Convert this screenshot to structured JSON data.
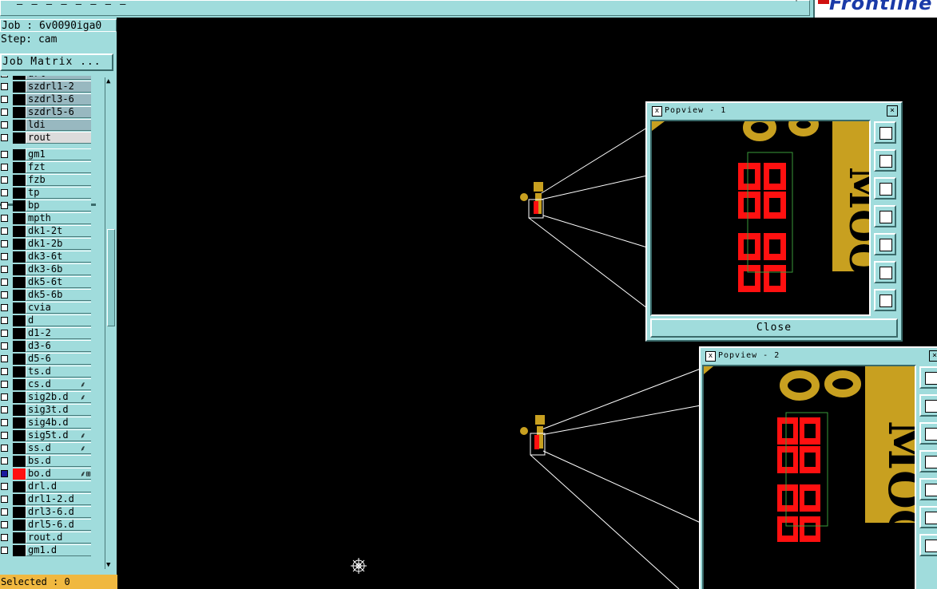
{
  "window": {
    "title": "–   –    –    –    –    –    –   –",
    "logo_text": "Frontline",
    "corner_mark": "'"
  },
  "sidebar": {
    "job": "Job : 6v0090iga0",
    "step": "Step: cam",
    "matrix_button": "Job Matrix ...",
    "layers": [
      {
        "name": "drl",
        "style": "grey",
        "checked": false
      },
      {
        "name": "szdrl1-2",
        "style": "grey",
        "checked": false
      },
      {
        "name": "szdrl3-6",
        "style": "grey",
        "checked": false
      },
      {
        "name": "szdrl5-6",
        "style": "grey",
        "checked": false
      },
      {
        "name": "ldi",
        "style": "grey",
        "checked": false
      },
      {
        "name": "rout",
        "style": "light",
        "checked": false
      },
      {
        "name": "gm1",
        "style": "normal",
        "checked": false
      },
      {
        "name": "fzt",
        "style": "normal",
        "checked": false
      },
      {
        "name": "fzb",
        "style": "normal",
        "checked": false
      },
      {
        "name": "tp",
        "style": "normal",
        "checked": false
      },
      {
        "name": "bp",
        "style": "normal",
        "checked": false
      },
      {
        "name": "mpth",
        "style": "normal",
        "checked": false
      },
      {
        "name": "dk1-2t",
        "style": "normal",
        "checked": false
      },
      {
        "name": "dk1-2b",
        "style": "normal",
        "checked": false
      },
      {
        "name": "dk3-6t",
        "style": "normal",
        "checked": false
      },
      {
        "name": "dk3-6b",
        "style": "normal",
        "checked": false
      },
      {
        "name": "dk5-6t",
        "style": "normal",
        "checked": false
      },
      {
        "name": "dk5-6b",
        "style": "normal",
        "checked": false
      },
      {
        "name": "cvia",
        "style": "normal",
        "checked": false
      },
      {
        "name": "d",
        "style": "normal",
        "checked": false
      },
      {
        "name": "d1-2",
        "style": "normal",
        "checked": false
      },
      {
        "name": "d3-6",
        "style": "normal",
        "checked": false
      },
      {
        "name": "d5-6",
        "style": "normal",
        "checked": false
      },
      {
        "name": "ts.d",
        "style": "normal",
        "checked": false
      },
      {
        "name": "cs.d",
        "style": "normal",
        "checked": false,
        "flag": "⸙"
      },
      {
        "name": "sig2b.d",
        "style": "normal",
        "checked": false,
        "flag": "⸙"
      },
      {
        "name": "sig3t.d",
        "style": "normal",
        "checked": false
      },
      {
        "name": "sig4b.d",
        "style": "normal",
        "checked": false
      },
      {
        "name": "sig5t.d",
        "style": "normal",
        "checked": false,
        "flag": "⸙"
      },
      {
        "name": "ss.d",
        "style": "normal",
        "checked": false,
        "flag": "⸙"
      },
      {
        "name": "bs.d",
        "style": "normal",
        "checked": false
      },
      {
        "name": "bo.d",
        "style": "normal",
        "checked": true,
        "color": "red",
        "flag": "⸙⊞"
      },
      {
        "name": "drl.d",
        "style": "normal",
        "checked": false
      },
      {
        "name": "drl1-2.d",
        "style": "normal",
        "checked": false
      },
      {
        "name": "drl3-6.d",
        "style": "normal",
        "checked": false
      },
      {
        "name": "drl5-6.d",
        "style": "normal",
        "checked": false
      },
      {
        "name": "rout.d",
        "style": "normal",
        "checked": false
      },
      {
        "name": "gm1.d",
        "style": "normal",
        "checked": false
      }
    ],
    "status": "Selected : 0"
  },
  "popview1": {
    "title": "Popview - 1",
    "close_label": "Close"
  },
  "popview2": {
    "title": "Popview - 2"
  },
  "colors": {
    "panel": "#a0dcdc",
    "gold": "#c8a020",
    "red_pad": "#ff1010",
    "green_outline": "#3a9a3a",
    "status": "#f0b840"
  }
}
